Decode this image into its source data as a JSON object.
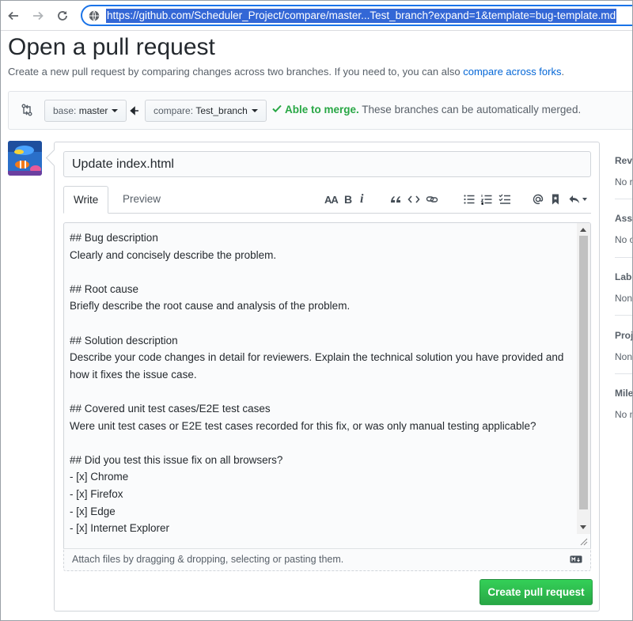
{
  "browser": {
    "url": "https://github.com/Scheduler_Project/compare/master...Test_branch?expand=1&template=bug-template.md"
  },
  "page": {
    "title": "Open a pull request",
    "description_prefix": "Create a new pull request by comparing changes across two branches. If you need to, you can also ",
    "description_link": "compare across forks",
    "description_suffix": "."
  },
  "compare": {
    "base_prefix": "base:",
    "base_branch": "master",
    "compare_prefix": "compare:",
    "compare_branch": "Test_branch",
    "merge_ok": "Able to merge.",
    "merge_text": "These branches can be automatically merged."
  },
  "form": {
    "title_value": "Update index.html",
    "tabs": [
      {
        "label": "Write"
      },
      {
        "label": "Preview"
      }
    ],
    "toolbar": {
      "heading": "AA",
      "bold": "B",
      "italic": "i"
    },
    "body": "## Bug description\nClearly and concisely describe the problem.\n\n## Root cause\nBriefly describe the root cause and analysis of the problem.\n\n## Solution description\nDescribe your code changes in detail for reviewers. Explain the technical solution you have provided and how it fixes the issue case.\n\n## Covered unit test cases/E2E test cases\nWere unit test cases or E2E test cases recorded for this fix, or was only manual testing applicable?\n\n## Did you test this issue fix on all browsers?\n- [x] Chrome\n- [x] Firefox\n- [x] Edge\n- [x] Internet Explorer",
    "attach_text": "Attach files by dragging & dropping, selecting or pasting them.",
    "submit_label": "Create pull request"
  },
  "sidebar": {
    "sections": [
      {
        "heading": "Revi",
        "value": "No r"
      },
      {
        "heading": "Assi",
        "value": "No o"
      },
      {
        "heading": "Labe",
        "value": "Non"
      },
      {
        "heading": "Proj",
        "value": "Non"
      },
      {
        "heading": "Mile",
        "value": "No n"
      }
    ]
  },
  "colors": {
    "link": "#0366d6",
    "success": "#28a745",
    "url_highlight": "#3367d6"
  }
}
